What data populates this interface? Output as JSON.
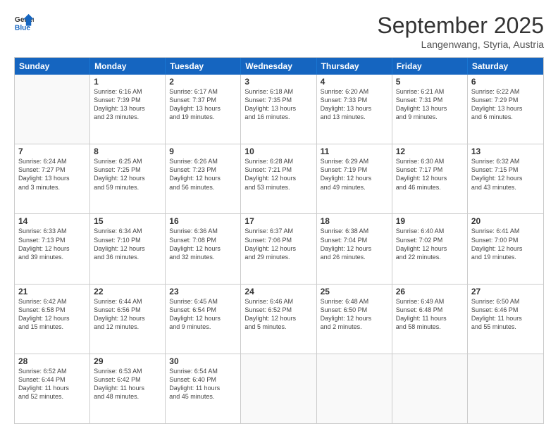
{
  "logo": {
    "line1": "General",
    "line2": "Blue"
  },
  "title": "September 2025",
  "subtitle": "Langenwang, Styria, Austria",
  "days": [
    "Sunday",
    "Monday",
    "Tuesday",
    "Wednesday",
    "Thursday",
    "Friday",
    "Saturday"
  ],
  "rows": [
    [
      {
        "day": "",
        "info": ""
      },
      {
        "day": "1",
        "info": "Sunrise: 6:16 AM\nSunset: 7:39 PM\nDaylight: 13 hours\nand 23 minutes."
      },
      {
        "day": "2",
        "info": "Sunrise: 6:17 AM\nSunset: 7:37 PM\nDaylight: 13 hours\nand 19 minutes."
      },
      {
        "day": "3",
        "info": "Sunrise: 6:18 AM\nSunset: 7:35 PM\nDaylight: 13 hours\nand 16 minutes."
      },
      {
        "day": "4",
        "info": "Sunrise: 6:20 AM\nSunset: 7:33 PM\nDaylight: 13 hours\nand 13 minutes."
      },
      {
        "day": "5",
        "info": "Sunrise: 6:21 AM\nSunset: 7:31 PM\nDaylight: 13 hours\nand 9 minutes."
      },
      {
        "day": "6",
        "info": "Sunrise: 6:22 AM\nSunset: 7:29 PM\nDaylight: 13 hours\nand 6 minutes."
      }
    ],
    [
      {
        "day": "7",
        "info": "Sunrise: 6:24 AM\nSunset: 7:27 PM\nDaylight: 13 hours\nand 3 minutes."
      },
      {
        "day": "8",
        "info": "Sunrise: 6:25 AM\nSunset: 7:25 PM\nDaylight: 12 hours\nand 59 minutes."
      },
      {
        "day": "9",
        "info": "Sunrise: 6:26 AM\nSunset: 7:23 PM\nDaylight: 12 hours\nand 56 minutes."
      },
      {
        "day": "10",
        "info": "Sunrise: 6:28 AM\nSunset: 7:21 PM\nDaylight: 12 hours\nand 53 minutes."
      },
      {
        "day": "11",
        "info": "Sunrise: 6:29 AM\nSunset: 7:19 PM\nDaylight: 12 hours\nand 49 minutes."
      },
      {
        "day": "12",
        "info": "Sunrise: 6:30 AM\nSunset: 7:17 PM\nDaylight: 12 hours\nand 46 minutes."
      },
      {
        "day": "13",
        "info": "Sunrise: 6:32 AM\nSunset: 7:15 PM\nDaylight: 12 hours\nand 43 minutes."
      }
    ],
    [
      {
        "day": "14",
        "info": "Sunrise: 6:33 AM\nSunset: 7:13 PM\nDaylight: 12 hours\nand 39 minutes."
      },
      {
        "day": "15",
        "info": "Sunrise: 6:34 AM\nSunset: 7:10 PM\nDaylight: 12 hours\nand 36 minutes."
      },
      {
        "day": "16",
        "info": "Sunrise: 6:36 AM\nSunset: 7:08 PM\nDaylight: 12 hours\nand 32 minutes."
      },
      {
        "day": "17",
        "info": "Sunrise: 6:37 AM\nSunset: 7:06 PM\nDaylight: 12 hours\nand 29 minutes."
      },
      {
        "day": "18",
        "info": "Sunrise: 6:38 AM\nSunset: 7:04 PM\nDaylight: 12 hours\nand 26 minutes."
      },
      {
        "day": "19",
        "info": "Sunrise: 6:40 AM\nSunset: 7:02 PM\nDaylight: 12 hours\nand 22 minutes."
      },
      {
        "day": "20",
        "info": "Sunrise: 6:41 AM\nSunset: 7:00 PM\nDaylight: 12 hours\nand 19 minutes."
      }
    ],
    [
      {
        "day": "21",
        "info": "Sunrise: 6:42 AM\nSunset: 6:58 PM\nDaylight: 12 hours\nand 15 minutes."
      },
      {
        "day": "22",
        "info": "Sunrise: 6:44 AM\nSunset: 6:56 PM\nDaylight: 12 hours\nand 12 minutes."
      },
      {
        "day": "23",
        "info": "Sunrise: 6:45 AM\nSunset: 6:54 PM\nDaylight: 12 hours\nand 9 minutes."
      },
      {
        "day": "24",
        "info": "Sunrise: 6:46 AM\nSunset: 6:52 PM\nDaylight: 12 hours\nand 5 minutes."
      },
      {
        "day": "25",
        "info": "Sunrise: 6:48 AM\nSunset: 6:50 PM\nDaylight: 12 hours\nand 2 minutes."
      },
      {
        "day": "26",
        "info": "Sunrise: 6:49 AM\nSunset: 6:48 PM\nDaylight: 11 hours\nand 58 minutes."
      },
      {
        "day": "27",
        "info": "Sunrise: 6:50 AM\nSunset: 6:46 PM\nDaylight: 11 hours\nand 55 minutes."
      }
    ],
    [
      {
        "day": "28",
        "info": "Sunrise: 6:52 AM\nSunset: 6:44 PM\nDaylight: 11 hours\nand 52 minutes."
      },
      {
        "day": "29",
        "info": "Sunrise: 6:53 AM\nSunset: 6:42 PM\nDaylight: 11 hours\nand 48 minutes."
      },
      {
        "day": "30",
        "info": "Sunrise: 6:54 AM\nSunset: 6:40 PM\nDaylight: 11 hours\nand 45 minutes."
      },
      {
        "day": "",
        "info": ""
      },
      {
        "day": "",
        "info": ""
      },
      {
        "day": "",
        "info": ""
      },
      {
        "day": "",
        "info": ""
      }
    ]
  ]
}
